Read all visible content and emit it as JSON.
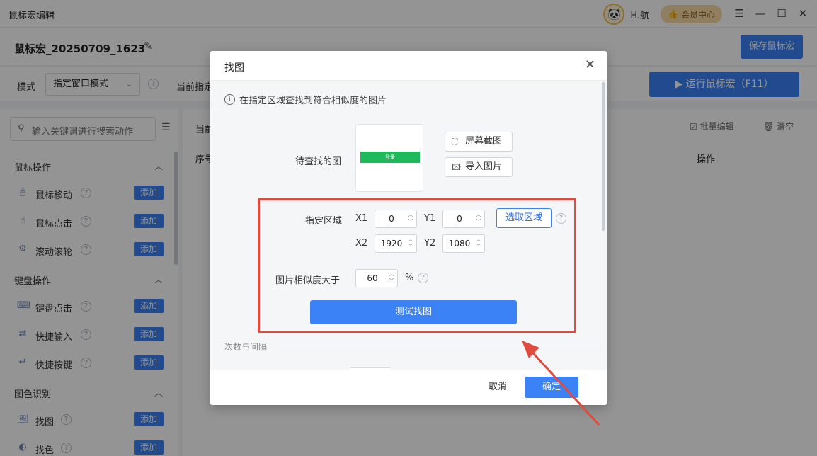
{
  "app": {
    "title": "鼠标宏编辑",
    "username": "H.航",
    "vip_label": "会员中心"
  },
  "header": {
    "macro_name": "鼠标宏_20250709_1623",
    "save_label": "保存鼠标宏"
  },
  "modebar": {
    "mode_label": "模式",
    "mode_value": "指定窗口模式",
    "current_label": "当前指定",
    "run_label": "运行鼠标宏（F11）"
  },
  "sidebar": {
    "search_placeholder": "输入关键词进行搜索动作",
    "add_label": "添加",
    "groups": [
      {
        "title": "鼠标操作",
        "items": [
          "鼠标移动",
          "鼠标点击",
          "滚动滚轮"
        ]
      },
      {
        "title": "键盘操作",
        "items": [
          "键盘点击",
          "快捷输入",
          "快捷按键"
        ]
      },
      {
        "title": "图色识别",
        "items": [
          "找图",
          "找色"
        ]
      }
    ]
  },
  "main": {
    "current_label": "当前",
    "batch_edit": "批量编辑",
    "clear": "清空",
    "col_seq": "序号",
    "col_op": "操作"
  },
  "dialog": {
    "title": "找图",
    "info": "在指定区域查找到符合相似度的图片",
    "target_label": "待查找的图",
    "preview_text": "登录",
    "screenshot_btn": "屏幕截图",
    "import_btn": "导入图片",
    "region_label": "指定区域",
    "x1_label": "X1",
    "x1_value": "0",
    "y1_label": "Y1",
    "y1_value": "0",
    "x2_label": "X2",
    "x2_value": "1920",
    "y2_label": "Y2",
    "y2_value": "1080",
    "select_region_btn": "选取区域",
    "similarity_label": "图片相似度大于",
    "similarity_value": "60",
    "similarity_unit": "%",
    "test_btn": "测试找图",
    "section_label": "次数与间隔",
    "cancel": "取消",
    "ok": "确定"
  },
  "colors": {
    "primary": "#3b82f6",
    "annotation_red": "#e04a3f",
    "preview_green": "#1fb85a"
  }
}
